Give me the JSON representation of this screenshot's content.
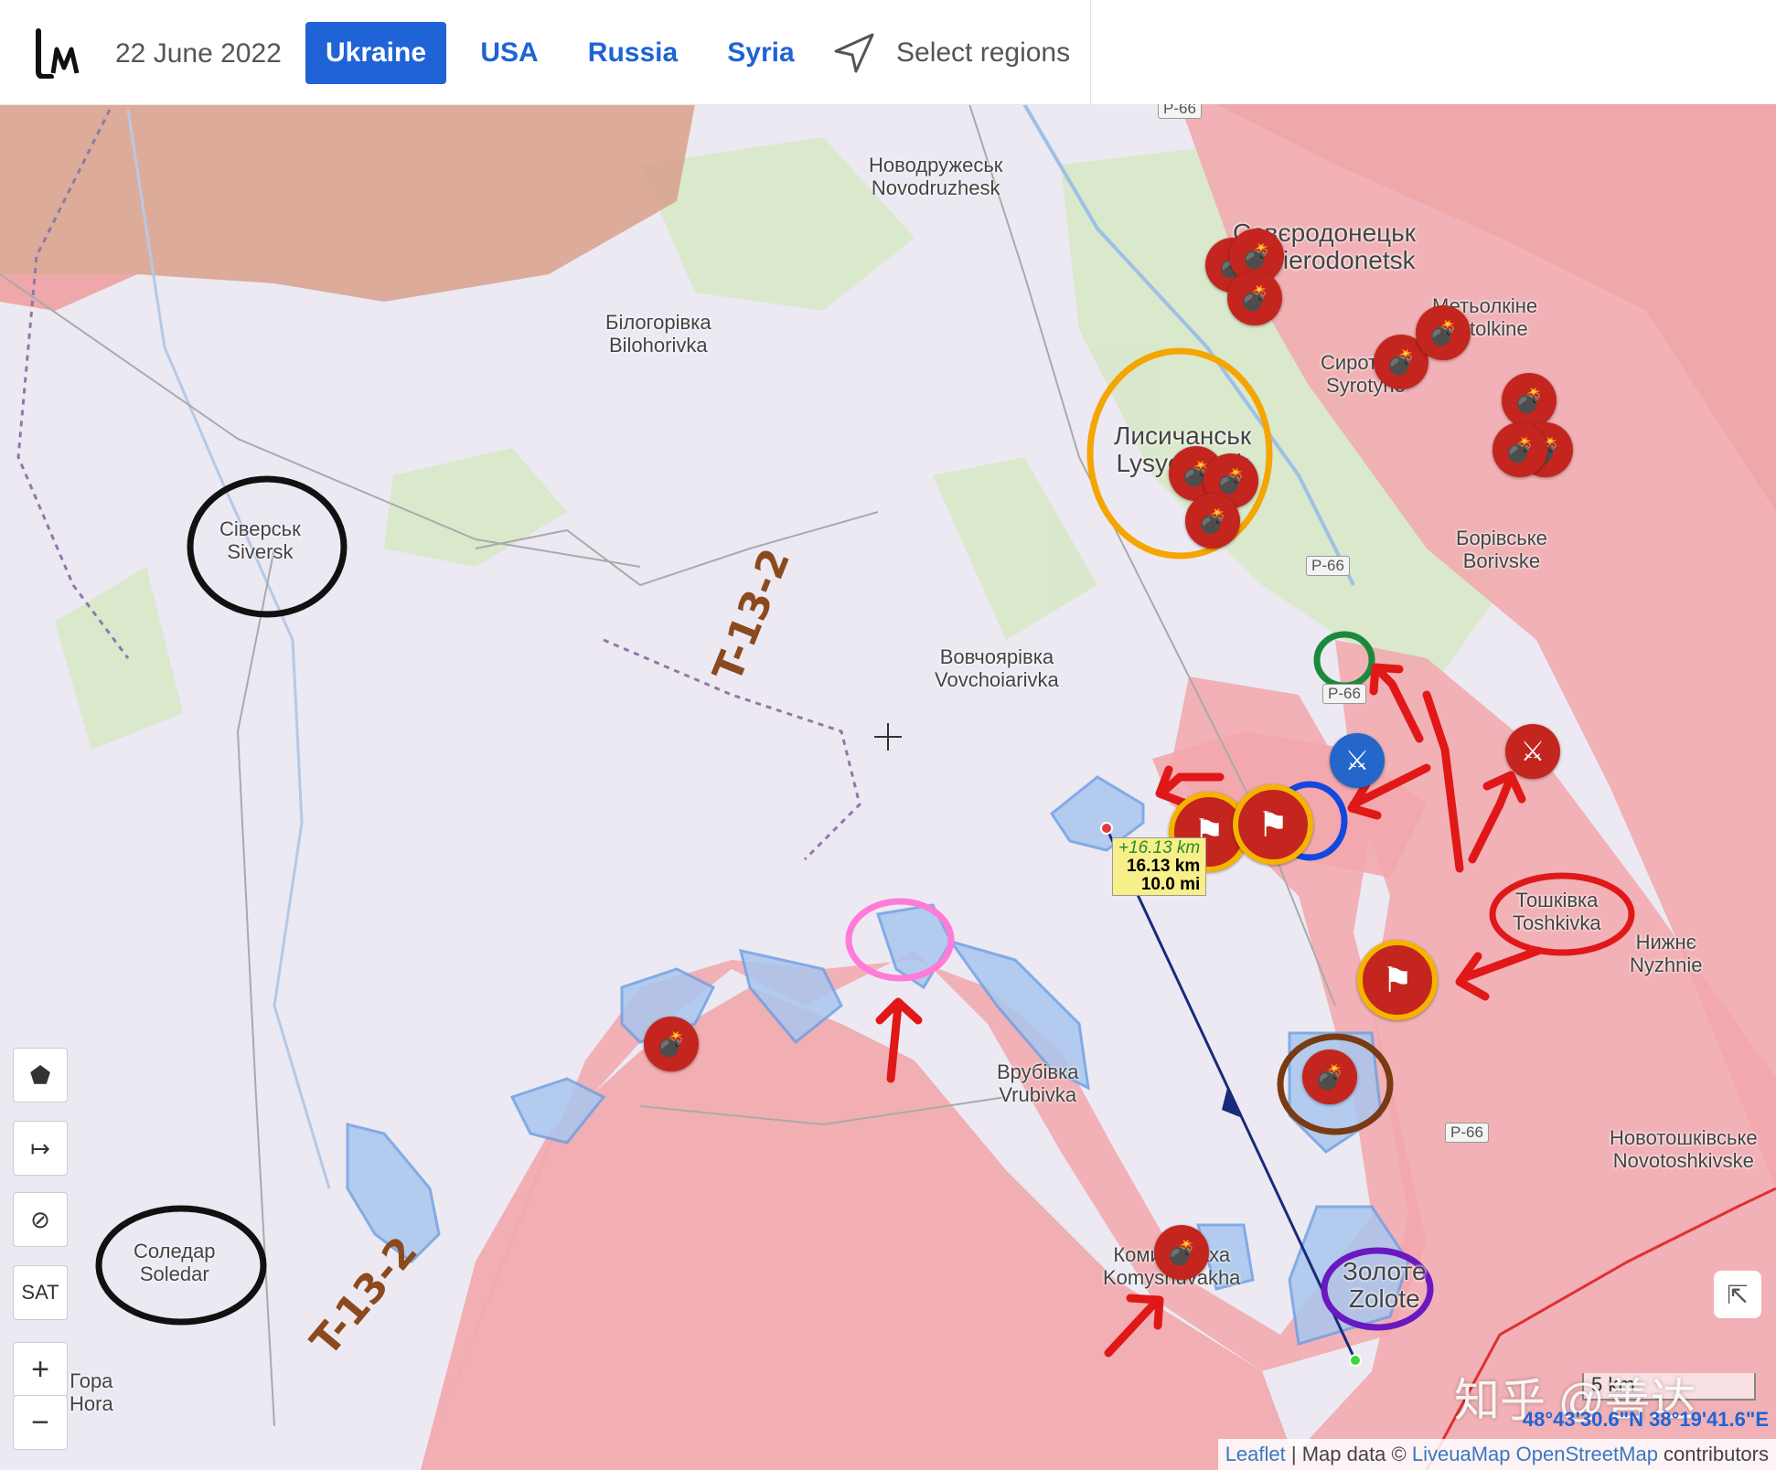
{
  "header": {
    "logo_text": "LM",
    "date": "22 June 2022",
    "tabs": [
      {
        "label": "Ukraine",
        "active": true
      },
      {
        "label": "USA",
        "active": false
      },
      {
        "label": "Russia",
        "active": false
      },
      {
        "label": "Syria",
        "active": false
      }
    ],
    "select_regions": "Select regions",
    "select_icon": "navigation-arrow-icon"
  },
  "map": {
    "places": [
      {
        "id": "novodruzhesk",
        "uk": "Новодружеськ",
        "en": "Novodruzhesk"
      },
      {
        "id": "sievierodonetsk",
        "uk": "Сєвєродонецьк",
        "en": "Sievierodonetsk"
      },
      {
        "id": "bilohorivka",
        "uk": "Білогорівка",
        "en": "Bilohorivka"
      },
      {
        "id": "metolkine",
        "uk": "Метьолкіне",
        "en": "Metolkine"
      },
      {
        "id": "syrotyne",
        "uk": "Сиротине",
        "en": "Syrotyne"
      },
      {
        "id": "lysychansk",
        "uk": "Лисичанськ",
        "en": "Lysychansk"
      },
      {
        "id": "siversk",
        "uk": "Сіверськ",
        "en": "Siversk"
      },
      {
        "id": "borivske",
        "uk": "Борівське",
        "en": "Borivske"
      },
      {
        "id": "vovchoiarivka",
        "uk": "Вовчоярівка",
        "en": "Vovchoiarivka"
      },
      {
        "id": "toshkivka",
        "uk": "Тошківка",
        "en": "Toshkivka"
      },
      {
        "id": "nyzhnie",
        "uk": "Нижнє",
        "en": "Nyzhnie"
      },
      {
        "id": "vrubivka",
        "uk": "Врубівка",
        "en": "Vrubivka"
      },
      {
        "id": "novotoshkivske",
        "uk": "Новотошківське",
        "en": "Novotoshkivske"
      },
      {
        "id": "soledar",
        "uk": "Соледар",
        "en": "Soledar"
      },
      {
        "id": "komyshuvakha",
        "uk": "Комишуваха",
        "en": "Komyshuvakha"
      },
      {
        "id": "zolote",
        "uk": "Золоте",
        "en": "Zolote"
      },
      {
        "id": "hora",
        "uk": "Гора",
        "en": "Hora"
      }
    ],
    "road_labels": [
      "Р-66",
      "Р-66",
      "Р-66",
      "Р-66"
    ],
    "measure": {
      "delta": "+16.13 km",
      "km": "16.13 km",
      "mi": "10.0 mi"
    },
    "scale_label": "5 km",
    "coordinates": "48°43'30.6\"N 38°19'41.6\"E",
    "attribution": {
      "leaflet": "Leaflet",
      "sep": " | Map data © ",
      "livemap": "LiveuaMap",
      "osm": "OpenStreetMap",
      "suffix": " contributors"
    },
    "controls": {
      "polygon": "⬟",
      "measure": "↦",
      "hide": "⊘",
      "sat": "SAT",
      "zoom_in": "+",
      "zoom_out": "−"
    },
    "annotations": {
      "t13_upper": "T-13-2",
      "t13_lower": "T-13-2"
    },
    "watermark": "知乎 @善达",
    "colors": {
      "russian_control": "#f2a7ac",
      "russia_territory": "#d9a08a",
      "contested": "#a9c6ee",
      "bomb_marker": "#c4251e",
      "flag_ring": "#f5b400",
      "ukraine_marker": "#2466c9"
    }
  }
}
